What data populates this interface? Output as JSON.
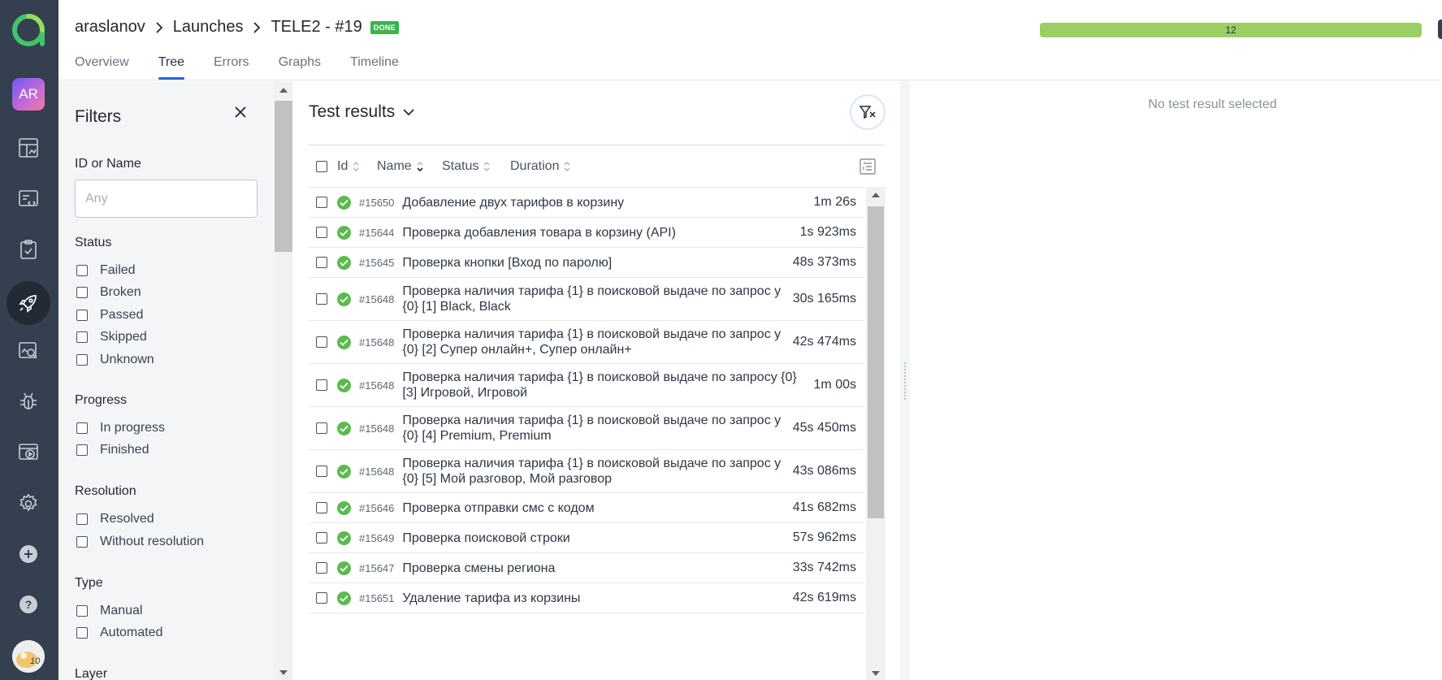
{
  "nav": {
    "avatar_initials": "AR",
    "items": [
      "dashboards-icon",
      "test-cases-icon",
      "test-plans-icon",
      "launches-icon",
      "analytics-icon",
      "defects-icon",
      "jobs-icon",
      "settings-icon",
      "add-icon",
      "help-icon"
    ],
    "active_item": "launches-icon",
    "user_avatar_text": "10"
  },
  "header": {
    "breadcrumb": [
      "araslanov",
      "Launches",
      "TELE2 - #19"
    ],
    "status_badge": "DONE",
    "tabs": [
      "Overview",
      "Tree",
      "Errors",
      "Graphs",
      "Timeline"
    ],
    "active_tab": "Tree",
    "progress_count": "12",
    "progress_color": "#9bcf63"
  },
  "filters": {
    "title": "Filters",
    "id_label": "ID or Name",
    "id_placeholder": "Any",
    "groups": [
      {
        "label": "Status",
        "options": [
          "Failed",
          "Broken",
          "Passed",
          "Skipped",
          "Unknown"
        ]
      },
      {
        "label": "Progress",
        "options": [
          "In progress",
          "Finished"
        ]
      },
      {
        "label": "Resolution",
        "options": [
          "Resolved",
          "Without resolution"
        ]
      },
      {
        "label": "Type",
        "options": [
          "Manual",
          "Automated"
        ]
      },
      {
        "label": "Layer",
        "options": []
      }
    ]
  },
  "results": {
    "title": "Test results",
    "columns": [
      "Id",
      "Name",
      "Status",
      "Duration"
    ],
    "rows": [
      {
        "id": "#15650",
        "name": "Добавление двух тарифов в корзину",
        "duration": "1m 26s",
        "status": "passed"
      },
      {
        "id": "#15644",
        "name": "Проверка добавления товара в корзину (API)",
        "duration": "1s 923ms",
        "status": "passed"
      },
      {
        "id": "#15645",
        "name": "Проверка кнопки [Вход по паролю]",
        "duration": "48s 373ms",
        "status": "passed"
      },
      {
        "id": "#15648",
        "name": "Проверка наличия тарифа {1} в поисковой выдаче по запрос у {0} [1] Black, Black",
        "duration": "30s 165ms",
        "status": "passed"
      },
      {
        "id": "#15648",
        "name": "Проверка наличия тарифа {1} в поисковой выдаче по запрос у {0} [2] Супер онлайн+, Супер онлайн+",
        "duration": "42s 474ms",
        "status": "passed"
      },
      {
        "id": "#15648",
        "name": "Проверка наличия тарифа {1} в поисковой выдаче по запросу {0} [3] Игровой, Игровой",
        "duration": "1m 00s",
        "status": "passed"
      },
      {
        "id": "#15648",
        "name": "Проверка наличия тарифа {1} в поисковой выдаче по запрос у {0} [4] Premium, Premium",
        "duration": "45s 450ms",
        "status": "passed"
      },
      {
        "id": "#15648",
        "name": "Проверка наличия тарифа {1} в поисковой выдаче по запрос у {0} [5] Мой разговор, Мой разговор",
        "duration": "43s 086ms",
        "status": "passed"
      },
      {
        "id": "#15646",
        "name": "Проверка отправки смс с кодом",
        "duration": "41s 682ms",
        "status": "passed"
      },
      {
        "id": "#15649",
        "name": "Проверка поисковой строки",
        "duration": "57s 962ms",
        "status": "passed"
      },
      {
        "id": "#15647",
        "name": "Проверка смены региона",
        "duration": "33s 742ms",
        "status": "passed"
      },
      {
        "id": "#15651",
        "name": "Удаление тарифа из корзины",
        "duration": "42s 619ms",
        "status": "passed"
      }
    ],
    "status_color": "#5cba4f"
  },
  "details": {
    "empty_text": "No test result selected"
  }
}
